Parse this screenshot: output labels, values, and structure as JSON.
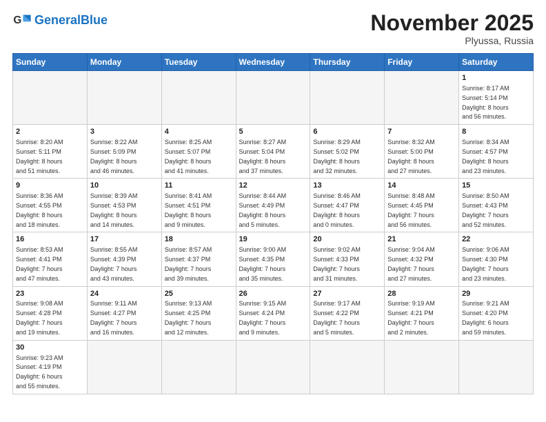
{
  "logo": {
    "general": "General",
    "blue": "Blue"
  },
  "header": {
    "month": "November 2025",
    "location": "Plyussa, Russia"
  },
  "weekdays": [
    "Sunday",
    "Monday",
    "Tuesday",
    "Wednesday",
    "Thursday",
    "Friday",
    "Saturday"
  ],
  "weeks": [
    [
      {
        "day": "",
        "info": ""
      },
      {
        "day": "",
        "info": ""
      },
      {
        "day": "",
        "info": ""
      },
      {
        "day": "",
        "info": ""
      },
      {
        "day": "",
        "info": ""
      },
      {
        "day": "",
        "info": ""
      },
      {
        "day": "1",
        "info": "Sunrise: 8:17 AM\nSunset: 5:14 PM\nDaylight: 8 hours\nand 56 minutes."
      }
    ],
    [
      {
        "day": "2",
        "info": "Sunrise: 8:20 AM\nSunset: 5:11 PM\nDaylight: 8 hours\nand 51 minutes."
      },
      {
        "day": "3",
        "info": "Sunrise: 8:22 AM\nSunset: 5:09 PM\nDaylight: 8 hours\nand 46 minutes."
      },
      {
        "day": "4",
        "info": "Sunrise: 8:25 AM\nSunset: 5:07 PM\nDaylight: 8 hours\nand 41 minutes."
      },
      {
        "day": "5",
        "info": "Sunrise: 8:27 AM\nSunset: 5:04 PM\nDaylight: 8 hours\nand 37 minutes."
      },
      {
        "day": "6",
        "info": "Sunrise: 8:29 AM\nSunset: 5:02 PM\nDaylight: 8 hours\nand 32 minutes."
      },
      {
        "day": "7",
        "info": "Sunrise: 8:32 AM\nSunset: 5:00 PM\nDaylight: 8 hours\nand 27 minutes."
      },
      {
        "day": "8",
        "info": "Sunrise: 8:34 AM\nSunset: 4:57 PM\nDaylight: 8 hours\nand 23 minutes."
      }
    ],
    [
      {
        "day": "9",
        "info": "Sunrise: 8:36 AM\nSunset: 4:55 PM\nDaylight: 8 hours\nand 18 minutes."
      },
      {
        "day": "10",
        "info": "Sunrise: 8:39 AM\nSunset: 4:53 PM\nDaylight: 8 hours\nand 14 minutes."
      },
      {
        "day": "11",
        "info": "Sunrise: 8:41 AM\nSunset: 4:51 PM\nDaylight: 8 hours\nand 9 minutes."
      },
      {
        "day": "12",
        "info": "Sunrise: 8:44 AM\nSunset: 4:49 PM\nDaylight: 8 hours\nand 5 minutes."
      },
      {
        "day": "13",
        "info": "Sunrise: 8:46 AM\nSunset: 4:47 PM\nDaylight: 8 hours\nand 0 minutes."
      },
      {
        "day": "14",
        "info": "Sunrise: 8:48 AM\nSunset: 4:45 PM\nDaylight: 7 hours\nand 56 minutes."
      },
      {
        "day": "15",
        "info": "Sunrise: 8:50 AM\nSunset: 4:43 PM\nDaylight: 7 hours\nand 52 minutes."
      }
    ],
    [
      {
        "day": "16",
        "info": "Sunrise: 8:53 AM\nSunset: 4:41 PM\nDaylight: 7 hours\nand 47 minutes."
      },
      {
        "day": "17",
        "info": "Sunrise: 8:55 AM\nSunset: 4:39 PM\nDaylight: 7 hours\nand 43 minutes."
      },
      {
        "day": "18",
        "info": "Sunrise: 8:57 AM\nSunset: 4:37 PM\nDaylight: 7 hours\nand 39 minutes."
      },
      {
        "day": "19",
        "info": "Sunrise: 9:00 AM\nSunset: 4:35 PM\nDaylight: 7 hours\nand 35 minutes."
      },
      {
        "day": "20",
        "info": "Sunrise: 9:02 AM\nSunset: 4:33 PM\nDaylight: 7 hours\nand 31 minutes."
      },
      {
        "day": "21",
        "info": "Sunrise: 9:04 AM\nSunset: 4:32 PM\nDaylight: 7 hours\nand 27 minutes."
      },
      {
        "day": "22",
        "info": "Sunrise: 9:06 AM\nSunset: 4:30 PM\nDaylight: 7 hours\nand 23 minutes."
      }
    ],
    [
      {
        "day": "23",
        "info": "Sunrise: 9:08 AM\nSunset: 4:28 PM\nDaylight: 7 hours\nand 19 minutes."
      },
      {
        "day": "24",
        "info": "Sunrise: 9:11 AM\nSunset: 4:27 PM\nDaylight: 7 hours\nand 16 minutes."
      },
      {
        "day": "25",
        "info": "Sunrise: 9:13 AM\nSunset: 4:25 PM\nDaylight: 7 hours\nand 12 minutes."
      },
      {
        "day": "26",
        "info": "Sunrise: 9:15 AM\nSunset: 4:24 PM\nDaylight: 7 hours\nand 9 minutes."
      },
      {
        "day": "27",
        "info": "Sunrise: 9:17 AM\nSunset: 4:22 PM\nDaylight: 7 hours\nand 5 minutes."
      },
      {
        "day": "28",
        "info": "Sunrise: 9:19 AM\nSunset: 4:21 PM\nDaylight: 7 hours\nand 2 minutes."
      },
      {
        "day": "29",
        "info": "Sunrise: 9:21 AM\nSunset: 4:20 PM\nDaylight: 6 hours\nand 59 minutes."
      }
    ],
    [
      {
        "day": "30",
        "info": "Sunrise: 9:23 AM\nSunset: 4:19 PM\nDaylight: 6 hours\nand 55 minutes."
      },
      {
        "day": "",
        "info": ""
      },
      {
        "day": "",
        "info": ""
      },
      {
        "day": "",
        "info": ""
      },
      {
        "day": "",
        "info": ""
      },
      {
        "day": "",
        "info": ""
      },
      {
        "day": "",
        "info": ""
      }
    ]
  ]
}
